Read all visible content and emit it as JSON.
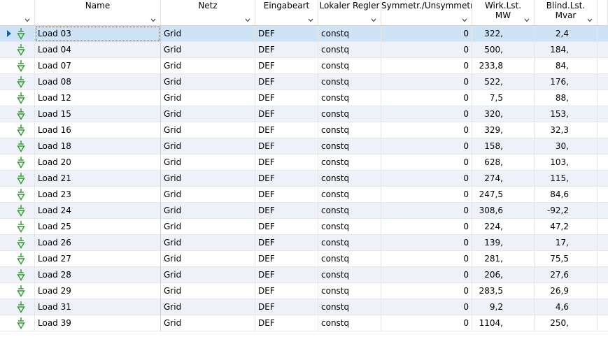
{
  "columns": {
    "name": "Name",
    "netz": "Netz",
    "eingabeart": "Eingabeart",
    "regler": "Lokaler Regler",
    "symm": "Symmetr./Unsymmetr.",
    "wirk_l1": "Wirk.Lst.",
    "wirk_l2": "MW",
    "blind_l1": "Blind.Lst.",
    "blind_l2": "Mvar"
  },
  "colors": {
    "selected_row": "#cfe3f7",
    "alt_row": "#eef2f8",
    "load_icon": "#2e9b2e",
    "row_arrow": "#1a5fb4"
  },
  "icons": {
    "row_indicator": "row-selector-arrow-icon",
    "load": "load-symbol-icon",
    "column_filter": "chevron-down-icon"
  },
  "rows": [
    {
      "name": "Load 03",
      "netz": "Grid",
      "eingabeart": "DEF",
      "regler": "constq",
      "symm": "0",
      "p": "322,",
      "q": "2,4"
    },
    {
      "name": "Load 04",
      "netz": "Grid",
      "eingabeart": "DEF",
      "regler": "constq",
      "symm": "0",
      "p": "500,",
      "q": "184,"
    },
    {
      "name": "Load 07",
      "netz": "Grid",
      "eingabeart": "DEF",
      "regler": "constq",
      "symm": "0",
      "p": "233,8",
      "q": "84,"
    },
    {
      "name": "Load 08",
      "netz": "Grid",
      "eingabeart": "DEF",
      "regler": "constq",
      "symm": "0",
      "p": "522,",
      "q": "176,"
    },
    {
      "name": "Load 12",
      "netz": "Grid",
      "eingabeart": "DEF",
      "regler": "constq",
      "symm": "0",
      "p": "7,5",
      "q": "88,"
    },
    {
      "name": "Load 15",
      "netz": "Grid",
      "eingabeart": "DEF",
      "regler": "constq",
      "symm": "0",
      "p": "320,",
      "q": "153,"
    },
    {
      "name": "Load 16",
      "netz": "Grid",
      "eingabeart": "DEF",
      "regler": "constq",
      "symm": "0",
      "p": "329,",
      "q": "32,3"
    },
    {
      "name": "Load 18",
      "netz": "Grid",
      "eingabeart": "DEF",
      "regler": "constq",
      "symm": "0",
      "p": "158,",
      "q": "30,"
    },
    {
      "name": "Load 20",
      "netz": "Grid",
      "eingabeart": "DEF",
      "regler": "constq",
      "symm": "0",
      "p": "628,",
      "q": "103,"
    },
    {
      "name": "Load 21",
      "netz": "Grid",
      "eingabeart": "DEF",
      "regler": "constq",
      "symm": "0",
      "p": "274,",
      "q": "115,"
    },
    {
      "name": "Load 23",
      "netz": "Grid",
      "eingabeart": "DEF",
      "regler": "constq",
      "symm": "0",
      "p": "247,5",
      "q": "84,6"
    },
    {
      "name": "Load 24",
      "netz": "Grid",
      "eingabeart": "DEF",
      "regler": "constq",
      "symm": "0",
      "p": "308,6",
      "q": "-92,2"
    },
    {
      "name": "Load 25",
      "netz": "Grid",
      "eingabeart": "DEF",
      "regler": "constq",
      "symm": "0",
      "p": "224,",
      "q": "47,2"
    },
    {
      "name": "Load 26",
      "netz": "Grid",
      "eingabeart": "DEF",
      "regler": "constq",
      "symm": "0",
      "p": "139,",
      "q": "17,"
    },
    {
      "name": "Load 27",
      "netz": "Grid",
      "eingabeart": "DEF",
      "regler": "constq",
      "symm": "0",
      "p": "281,",
      "q": "75,5"
    },
    {
      "name": "Load 28",
      "netz": "Grid",
      "eingabeart": "DEF",
      "regler": "constq",
      "symm": "0",
      "p": "206,",
      "q": "27,6"
    },
    {
      "name": "Load 29",
      "netz": "Grid",
      "eingabeart": "DEF",
      "regler": "constq",
      "symm": "0",
      "p": "283,5",
      "q": "26,9"
    },
    {
      "name": "Load 31",
      "netz": "Grid",
      "eingabeart": "DEF",
      "regler": "constq",
      "symm": "0",
      "p": "9,2",
      "q": "4,6"
    },
    {
      "name": "Load 39",
      "netz": "Grid",
      "eingabeart": "DEF",
      "regler": "constq",
      "symm": "0",
      "p": "1104,",
      "q": "250,"
    }
  ]
}
